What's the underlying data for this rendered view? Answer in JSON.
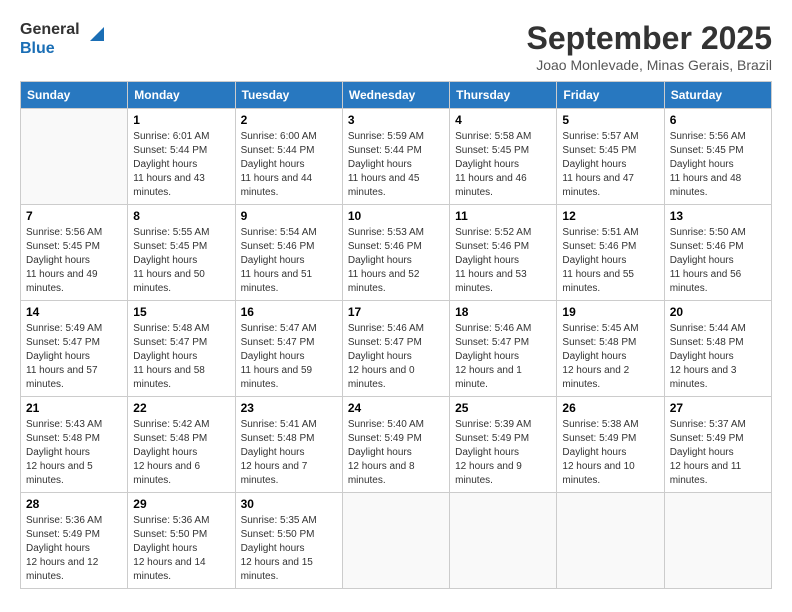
{
  "header": {
    "logo_line1": "General",
    "logo_line2": "Blue",
    "month": "September 2025",
    "location": "Joao Monlevade, Minas Gerais, Brazil"
  },
  "weekdays": [
    "Sunday",
    "Monday",
    "Tuesday",
    "Wednesday",
    "Thursday",
    "Friday",
    "Saturday"
  ],
  "weeks": [
    [
      {
        "day": "",
        "sunrise": "",
        "sunset": "",
        "daylight": ""
      },
      {
        "day": "1",
        "sunrise": "6:01 AM",
        "sunset": "5:44 PM",
        "daylight": "11 hours and 43 minutes."
      },
      {
        "day": "2",
        "sunrise": "6:00 AM",
        "sunset": "5:44 PM",
        "daylight": "11 hours and 44 minutes."
      },
      {
        "day": "3",
        "sunrise": "5:59 AM",
        "sunset": "5:44 PM",
        "daylight": "11 hours and 45 minutes."
      },
      {
        "day": "4",
        "sunrise": "5:58 AM",
        "sunset": "5:45 PM",
        "daylight": "11 hours and 46 minutes."
      },
      {
        "day": "5",
        "sunrise": "5:57 AM",
        "sunset": "5:45 PM",
        "daylight": "11 hours and 47 minutes."
      },
      {
        "day": "6",
        "sunrise": "5:56 AM",
        "sunset": "5:45 PM",
        "daylight": "11 hours and 48 minutes."
      }
    ],
    [
      {
        "day": "7",
        "sunrise": "5:56 AM",
        "sunset": "5:45 PM",
        "daylight": "11 hours and 49 minutes."
      },
      {
        "day": "8",
        "sunrise": "5:55 AM",
        "sunset": "5:45 PM",
        "daylight": "11 hours and 50 minutes."
      },
      {
        "day": "9",
        "sunrise": "5:54 AM",
        "sunset": "5:46 PM",
        "daylight": "11 hours and 51 minutes."
      },
      {
        "day": "10",
        "sunrise": "5:53 AM",
        "sunset": "5:46 PM",
        "daylight": "11 hours and 52 minutes."
      },
      {
        "day": "11",
        "sunrise": "5:52 AM",
        "sunset": "5:46 PM",
        "daylight": "11 hours and 53 minutes."
      },
      {
        "day": "12",
        "sunrise": "5:51 AM",
        "sunset": "5:46 PM",
        "daylight": "11 hours and 55 minutes."
      },
      {
        "day": "13",
        "sunrise": "5:50 AM",
        "sunset": "5:46 PM",
        "daylight": "11 hours and 56 minutes."
      }
    ],
    [
      {
        "day": "14",
        "sunrise": "5:49 AM",
        "sunset": "5:47 PM",
        "daylight": "11 hours and 57 minutes."
      },
      {
        "day": "15",
        "sunrise": "5:48 AM",
        "sunset": "5:47 PM",
        "daylight": "11 hours and 58 minutes."
      },
      {
        "day": "16",
        "sunrise": "5:47 AM",
        "sunset": "5:47 PM",
        "daylight": "11 hours and 59 minutes."
      },
      {
        "day": "17",
        "sunrise": "5:46 AM",
        "sunset": "5:47 PM",
        "daylight": "12 hours and 0 minutes."
      },
      {
        "day": "18",
        "sunrise": "5:46 AM",
        "sunset": "5:47 PM",
        "daylight": "12 hours and 1 minute."
      },
      {
        "day": "19",
        "sunrise": "5:45 AM",
        "sunset": "5:48 PM",
        "daylight": "12 hours and 2 minutes."
      },
      {
        "day": "20",
        "sunrise": "5:44 AM",
        "sunset": "5:48 PM",
        "daylight": "12 hours and 3 minutes."
      }
    ],
    [
      {
        "day": "21",
        "sunrise": "5:43 AM",
        "sunset": "5:48 PM",
        "daylight": "12 hours and 5 minutes."
      },
      {
        "day": "22",
        "sunrise": "5:42 AM",
        "sunset": "5:48 PM",
        "daylight": "12 hours and 6 minutes."
      },
      {
        "day": "23",
        "sunrise": "5:41 AM",
        "sunset": "5:48 PM",
        "daylight": "12 hours and 7 minutes."
      },
      {
        "day": "24",
        "sunrise": "5:40 AM",
        "sunset": "5:49 PM",
        "daylight": "12 hours and 8 minutes."
      },
      {
        "day": "25",
        "sunrise": "5:39 AM",
        "sunset": "5:49 PM",
        "daylight": "12 hours and 9 minutes."
      },
      {
        "day": "26",
        "sunrise": "5:38 AM",
        "sunset": "5:49 PM",
        "daylight": "12 hours and 10 minutes."
      },
      {
        "day": "27",
        "sunrise": "5:37 AM",
        "sunset": "5:49 PM",
        "daylight": "12 hours and 11 minutes."
      }
    ],
    [
      {
        "day": "28",
        "sunrise": "5:36 AM",
        "sunset": "5:49 PM",
        "daylight": "12 hours and 12 minutes."
      },
      {
        "day": "29",
        "sunrise": "5:36 AM",
        "sunset": "5:50 PM",
        "daylight": "12 hours and 14 minutes."
      },
      {
        "day": "30",
        "sunrise": "5:35 AM",
        "sunset": "5:50 PM",
        "daylight": "12 hours and 15 minutes."
      },
      {
        "day": "",
        "sunrise": "",
        "sunset": "",
        "daylight": ""
      },
      {
        "day": "",
        "sunrise": "",
        "sunset": "",
        "daylight": ""
      },
      {
        "day": "",
        "sunrise": "",
        "sunset": "",
        "daylight": ""
      },
      {
        "day": "",
        "sunrise": "",
        "sunset": "",
        "daylight": ""
      }
    ]
  ],
  "labels": {
    "sunrise": "Sunrise:",
    "sunset": "Sunset:",
    "daylight": "Daylight hours"
  }
}
